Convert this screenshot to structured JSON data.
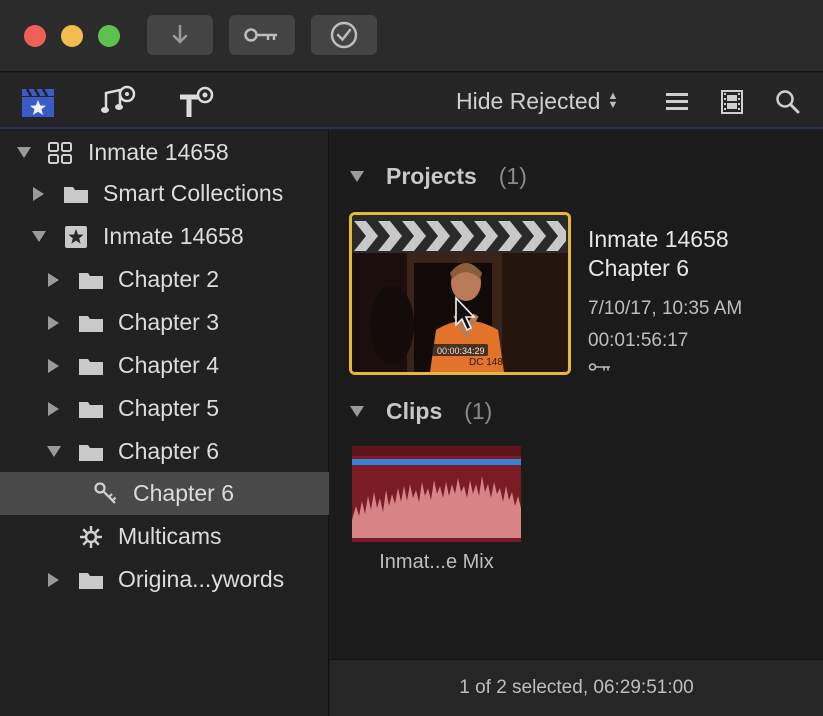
{
  "window": {
    "toolbar_buttons": [
      "import-icon",
      "key-icon",
      "checkmark-icon"
    ]
  },
  "toolbar": {
    "tabs": [
      "libraries-icon",
      "photos-audio-icon",
      "titles-generators-icon"
    ],
    "filter_label": "Hide Rejected",
    "view_icons": [
      "list-view-icon",
      "filmstrip-icon",
      "search-icon"
    ]
  },
  "sidebar": {
    "library_name": "Inmate 14658",
    "smart_collections": "Smart Collections",
    "event_name": "Inmate 14658",
    "chapter2": "Chapter 2",
    "chapter3": "Chapter 3",
    "chapter4": "Chapter 4",
    "chapter5": "Chapter 5",
    "chapter6": "Chapter 6",
    "keyword_chapter6": "Chapter 6",
    "multicams": "Multicams",
    "original_keywords": "Origina...ywords"
  },
  "browser": {
    "projects_header": "Projects",
    "projects_count": "(1)",
    "project": {
      "title_line1": "Inmate 14658",
      "title_line2": "Chapter 6",
      "date": "7/10/17, 10:35 AM",
      "duration": "00:01:56:17",
      "timecode_overlay": "00:00:34:29"
    },
    "clips_header": "Clips",
    "clips_count": "(1)",
    "clip": {
      "label": "Inmat...e Mix"
    }
  },
  "status": {
    "text": "1 of 2 selected, 06:29:51:00"
  },
  "colors": {
    "selection_border": "#e5b83a",
    "accent": "#3a5ac8",
    "clip_bg": "#7a1c23",
    "waveform": "#d88386",
    "audio_bar": "#3b7fd6"
  }
}
